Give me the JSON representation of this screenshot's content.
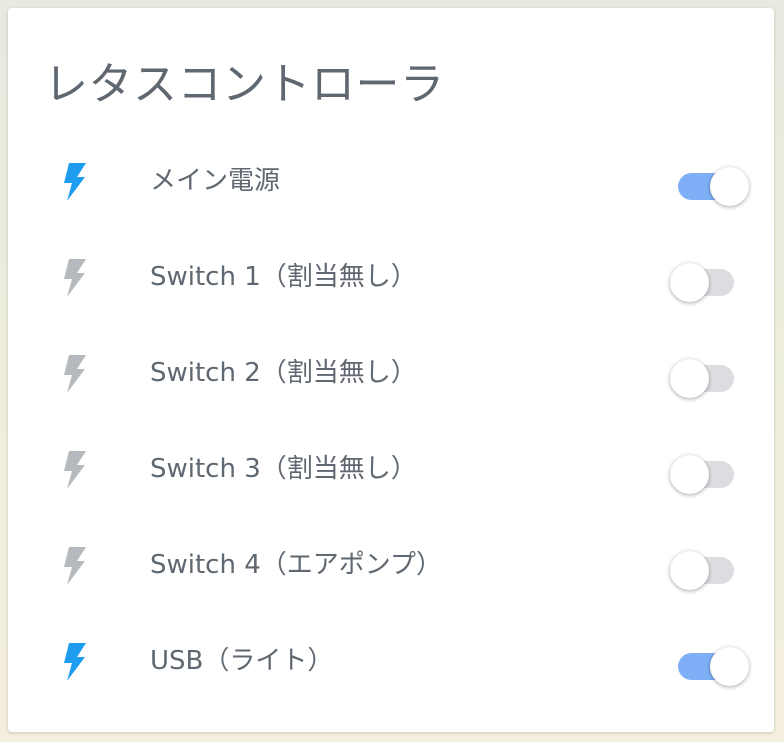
{
  "card": {
    "title": "レタスコントローラ"
  },
  "colors": {
    "active_icon": "#1e9cf0",
    "inactive_icon": "#b6b9be",
    "toggle_on_track": "#7fb0f7",
    "toggle_off_track": "#dcdde0",
    "text": "#5f6771"
  },
  "switches": [
    {
      "label": "メイン電源",
      "icon": "lightning-bolt-icon",
      "state": "on"
    },
    {
      "label": "Switch 1（割当無し）",
      "icon": "lightning-bolt-icon",
      "state": "off"
    },
    {
      "label": "Switch 2（割当無し）",
      "icon": "lightning-bolt-icon",
      "state": "off"
    },
    {
      "label": "Switch 3（割当無し）",
      "icon": "lightning-bolt-icon",
      "state": "off"
    },
    {
      "label": "Switch 4（エアポンプ）",
      "icon": "lightning-bolt-icon",
      "state": "off"
    },
    {
      "label": "USB（ライト）",
      "icon": "lightning-bolt-icon",
      "state": "on"
    }
  ]
}
